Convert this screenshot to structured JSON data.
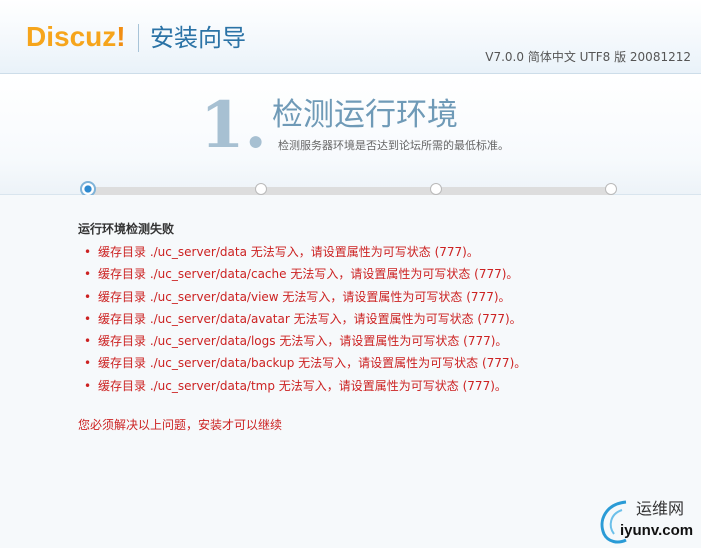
{
  "header": {
    "logo_main": "Discuz",
    "logo_bang": "!",
    "wizard_title": "安装向导",
    "version": "V7.0.0 简体中文 UTF8 版 20081212"
  },
  "step": {
    "number": "1.",
    "title": "检测运行环境",
    "description": "检测服务器环境是否达到论坛所需的最低标准。",
    "total_steps": 4,
    "current_step": 1
  },
  "check": {
    "fail_title": "运行环境检测失败",
    "bullet": "•",
    "errors": [
      "缓存目录 ./uc_server/data 无法写入，请设置属性为可写状态 (777)。",
      "缓存目录 ./uc_server/data/cache 无法写入，请设置属性为可写状态 (777)。",
      "缓存目录 ./uc_server/data/view 无法写入，请设置属性为可写状态 (777)。",
      "缓存目录 ./uc_server/data/avatar 无法写入，请设置属性为可写状态 (777)。",
      "缓存目录 ./uc_server/data/logs 无法写入，请设置属性为可写状态 (777)。",
      "缓存目录 ./uc_server/data/backup 无法写入，请设置属性为可写状态 (777)。",
      "缓存目录 ./uc_server/data/tmp 无法写入，请设置属性为可写状态 (777)。"
    ],
    "notice": "您必须解决以上问题，安装才可以继续"
  },
  "watermark": {
    "cn": "运维网",
    "en": "iyunv.com"
  },
  "colors": {
    "logo": "#f6a51c",
    "title_blue": "#2b73a6",
    "error_red": "#cc2222",
    "active_dot": "#2e8ad0"
  }
}
